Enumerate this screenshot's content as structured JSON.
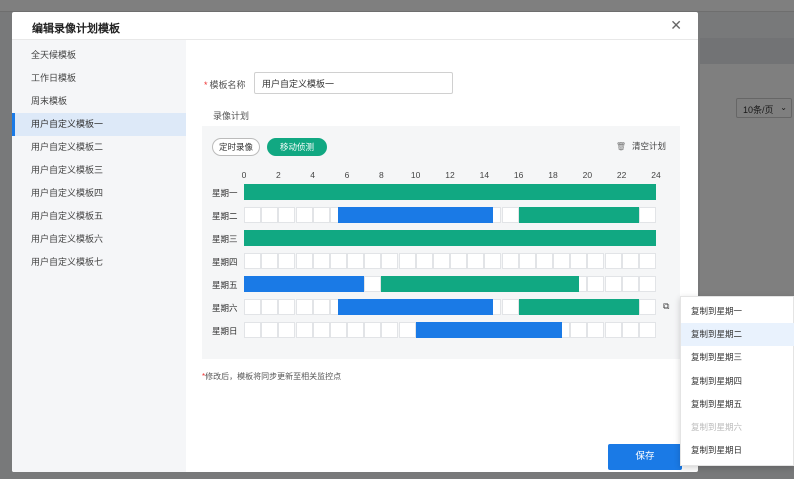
{
  "colors": {
    "motion": "#11a882",
    "timed": "#1a7ae6",
    "accent": "#1a7ae6"
  },
  "background": {
    "page_size": "10条/页"
  },
  "modal": {
    "title": "编辑录像计划模板",
    "close_icon": "close-icon"
  },
  "sidebar": {
    "items": [
      {
        "label": "全天候模板",
        "active": false
      },
      {
        "label": "工作日模板",
        "active": false
      },
      {
        "label": "周末模板",
        "active": false
      },
      {
        "label": "用户自定义模板一",
        "active": true
      },
      {
        "label": "用户自定义模板二",
        "active": false
      },
      {
        "label": "用户自定义模板三",
        "active": false
      },
      {
        "label": "用户自定义模板四",
        "active": false
      },
      {
        "label": "用户自定义模板五",
        "active": false
      },
      {
        "label": "用户自定义模板六",
        "active": false
      },
      {
        "label": "用户自定义模板七",
        "active": false
      }
    ]
  },
  "form": {
    "name_required": "*",
    "name_label": "模板名称",
    "name_value": "用户自定义模板一",
    "plan_label": "录像计划"
  },
  "schedule": {
    "modes": {
      "timed": "定时录像",
      "motion": "移动侦测",
      "selected": "motion"
    },
    "clear_label": "清空计划",
    "hour_labels": [
      "0",
      "2",
      "4",
      "6",
      "8",
      "10",
      "12",
      "14",
      "16",
      "18",
      "20",
      "22",
      "24"
    ],
    "days": [
      {
        "label": "星期一",
        "segments": [
          {
            "type": "motion",
            "start": 0,
            "end": 24
          }
        ]
      },
      {
        "label": "星期二",
        "segments": [
          {
            "type": "timed",
            "start": 5.5,
            "end": 14.5
          },
          {
            "type": "motion",
            "start": 16,
            "end": 23
          }
        ]
      },
      {
        "label": "星期三",
        "segments": [
          {
            "type": "motion",
            "start": 0,
            "end": 24
          }
        ]
      },
      {
        "label": "星期四",
        "segments": []
      },
      {
        "label": "星期五",
        "segments": [
          {
            "type": "timed",
            "start": 0,
            "end": 7
          },
          {
            "type": "motion",
            "start": 8,
            "end": 19.5
          }
        ]
      },
      {
        "label": "星期六",
        "segments": [
          {
            "type": "timed",
            "start": 5.5,
            "end": 14.5
          },
          {
            "type": "motion",
            "start": 16,
            "end": 23
          }
        ],
        "copy_open": true
      },
      {
        "label": "星期日",
        "segments": [
          {
            "type": "timed",
            "start": 10,
            "end": 18.5
          }
        ]
      }
    ]
  },
  "note": {
    "star": "*",
    "text": "修改后，模板将同步更新至相关监控点"
  },
  "save_label": "保存",
  "copy_menu": {
    "items": [
      {
        "label": "复制到星期一",
        "state": "normal"
      },
      {
        "label": "复制到星期二",
        "state": "hover"
      },
      {
        "label": "复制到星期三",
        "state": "normal"
      },
      {
        "label": "复制到星期四",
        "state": "normal"
      },
      {
        "label": "复制到星期五",
        "state": "normal"
      },
      {
        "label": "复制到星期六",
        "state": "disabled"
      },
      {
        "label": "复制到星期日",
        "state": "normal"
      }
    ]
  }
}
